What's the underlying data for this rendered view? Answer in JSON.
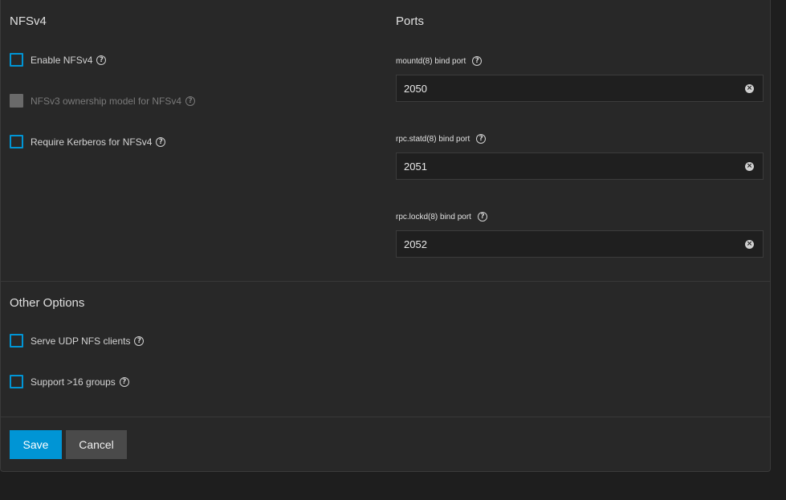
{
  "nfsv4": {
    "title": "NFSv4",
    "options": [
      {
        "label": "Enable NFSv4",
        "checked": false,
        "disabled": false
      },
      {
        "label": "NFSv3 ownership model for NFSv4",
        "checked": false,
        "disabled": true
      },
      {
        "label": "Require Kerberos for NFSv4",
        "checked": false,
        "disabled": false
      }
    ]
  },
  "ports": {
    "title": "Ports",
    "fields": [
      {
        "label": "mountd(8) bind port",
        "value": "2050"
      },
      {
        "label": "rpc.statd(8) bind port",
        "value": "2051"
      },
      {
        "label": "rpc.lockd(8) bind port",
        "value": "2052"
      }
    ]
  },
  "other": {
    "title": "Other Options",
    "options": [
      {
        "label": "Serve UDP NFS clients",
        "checked": false
      },
      {
        "label": "Support >16 groups",
        "checked": false
      }
    ]
  },
  "actions": {
    "save": "Save",
    "cancel": "Cancel"
  },
  "colors": {
    "accent": "#0095d5",
    "panel": "#282828",
    "background": "#1e1e1e"
  }
}
